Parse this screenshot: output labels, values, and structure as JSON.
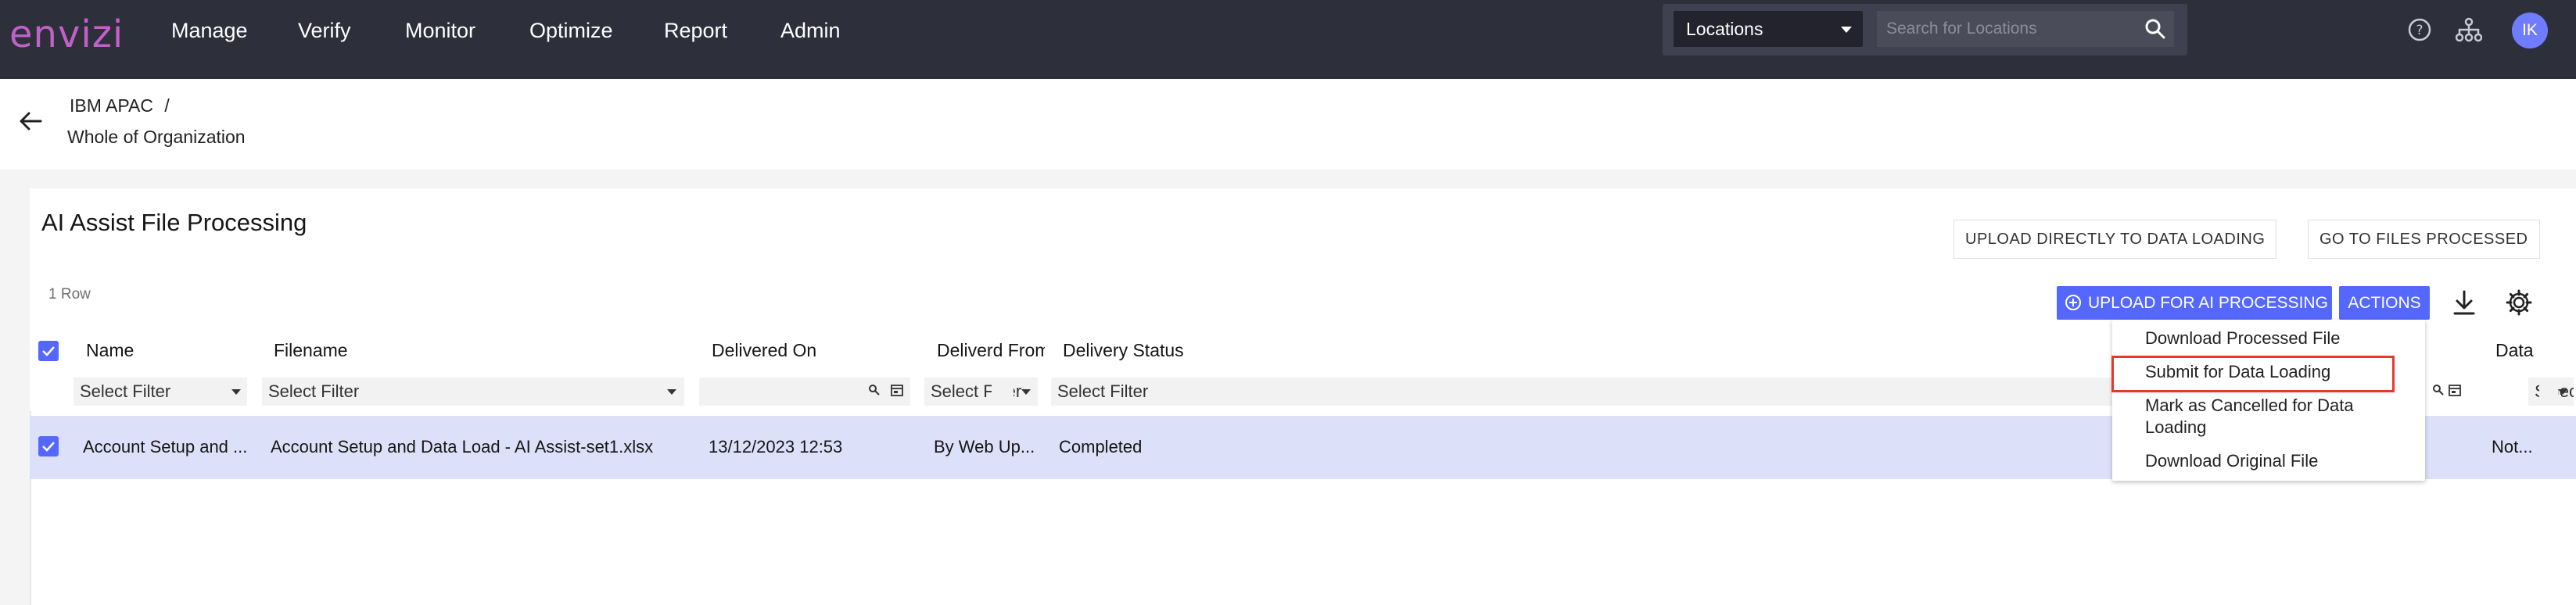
{
  "header": {
    "logo": "envizi",
    "nav": [
      "Manage",
      "Verify",
      "Monitor",
      "Optimize",
      "Report",
      "Admin"
    ],
    "search": {
      "scope": "Locations",
      "placeholder": "Search for Locations"
    },
    "user_initials": "IK"
  },
  "breadcrumb": {
    "parent": "IBM APAC",
    "separator": "/",
    "current": "Whole of Organization"
  },
  "page": {
    "title": "AI Assist File Processing",
    "upload_direct_label": "UPLOAD DIRECTLY TO DATA LOADING",
    "go_to_processed_label": "GO TO FILES PROCESSED",
    "row_count": "1 Row",
    "upload_ai_label": "UPLOAD FOR AI PROCESSING",
    "actions_label": "ACTIONS"
  },
  "table": {
    "columns": [
      "Name",
      "Filename",
      "Delivered On",
      "Deliverd From",
      "Delivery Status",
      "Data"
    ],
    "filters": {
      "name": "Select Filter",
      "filename": "Select Filter",
      "delivered_on": "",
      "delivered_from": "Select Filter",
      "delivery_status": "Select Filter",
      "data": "Select Filter"
    },
    "rows": [
      {
        "name": "Account Setup and ...",
        "filename": "Account Setup and Data Load - AI Assist-set1.xlsx",
        "delivered_on": "13/12/2023 12:53",
        "delivered_from": "By Web Up...",
        "status": "Completed",
        "data": "Not..."
      }
    ]
  },
  "actions_menu": {
    "items": [
      "Download Processed File",
      "Submit for Data Loading",
      "Mark as Cancelled for Data Loading",
      "Download Original File"
    ],
    "highlighted": "Submit for Data Loading"
  },
  "colors": {
    "topbar": "#2d2f3b",
    "accent": "#5468ff",
    "row_selected": "#dde0f9",
    "highlight_border": "#e13b2b",
    "logo": "#c061c9"
  }
}
